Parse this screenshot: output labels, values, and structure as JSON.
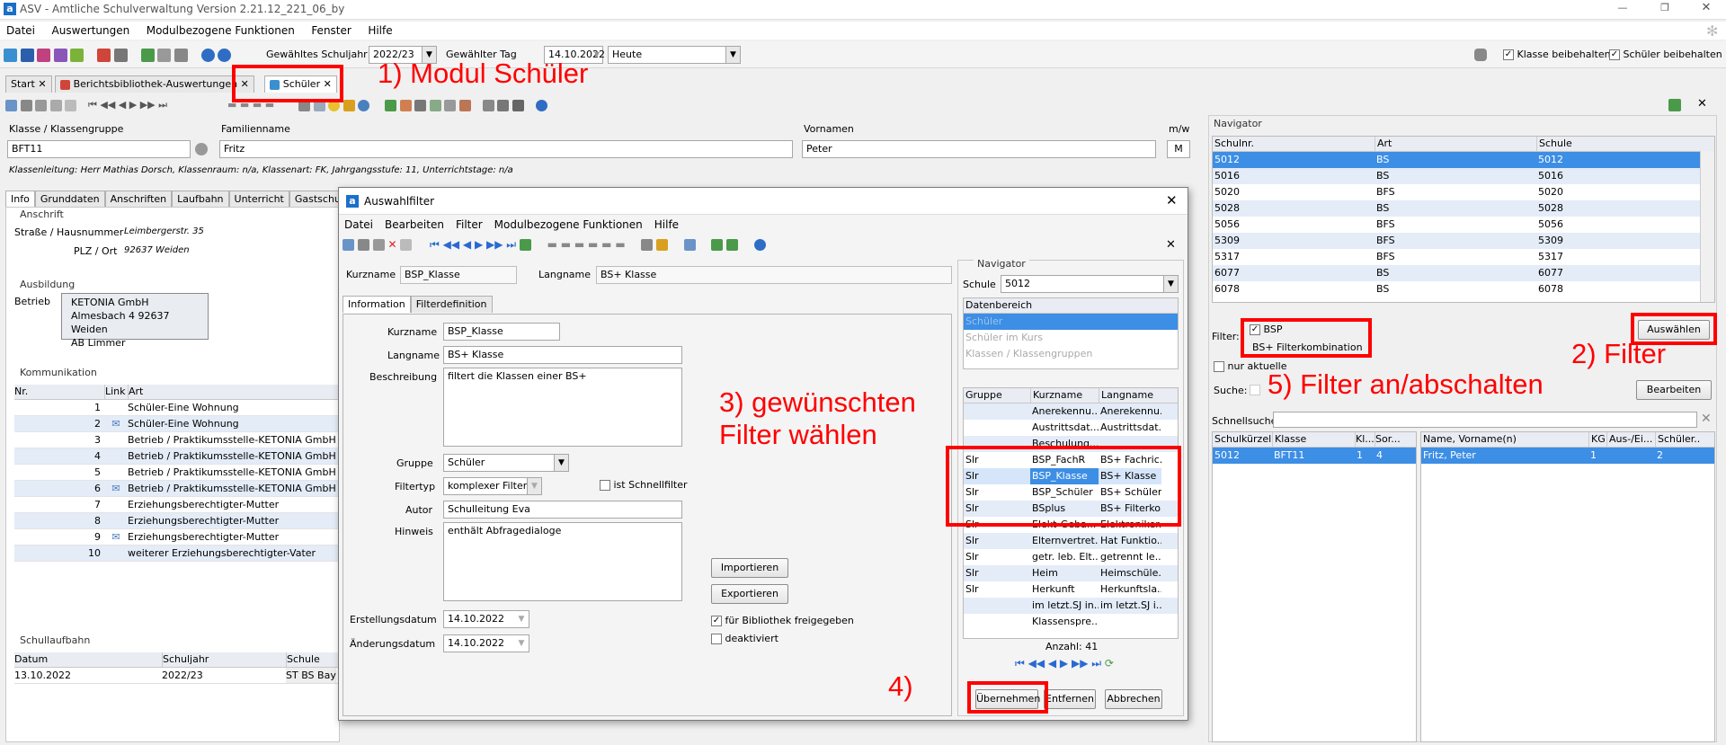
{
  "app": {
    "title": "ASV - Amtliche Schulverwaltung Version 2.21.12_221_06_by",
    "logo": "a"
  },
  "menu": [
    "Datei",
    "Auswertungen",
    "Modulbezogene Funktionen",
    "Fenster",
    "Hilfe"
  ],
  "toolbar": {
    "schuljahr_label": "Gewähltes Schuljahr",
    "schuljahr": "2022/23",
    "tag_label": "Gewählter Tag",
    "tag": "14.10.2022",
    "heute": "Heute",
    "klasse_beibehalten": "Klasse beibehalten",
    "schueler_beibehalten": "Schüler beibehalten"
  },
  "tabs": [
    "Start",
    "Berichtsbibliothek-Auswertungen",
    "Schüler"
  ],
  "student": {
    "klasse_label": "Klasse / Klassengruppe",
    "klasse": "BFT11",
    "familienname_label": "Familienname",
    "familienname": "Fritz",
    "vornamen_label": "Vornamen",
    "vornamen": "Peter",
    "mw_label": "m/w",
    "mw": "M",
    "info": "Klassenleitung: Herr Mathias Dorsch, Klassenraum: n/a, Klassenart: FK, Jahrgangsstufe: 11, Unterrichtstage: n/a"
  },
  "subtabs": [
    "Info",
    "Grunddaten",
    "Anschriften",
    "Laufbahn",
    "Unterricht",
    "Gastschulgene"
  ],
  "anschrift": {
    "title": "Anschrift",
    "strasse_label": "Straße / Hausnummer",
    "strasse": "Leimbergerstr. 35",
    "plz_label": "PLZ / Ort",
    "plz": "92637 Weiden"
  },
  "ausbildung": {
    "title": "Ausbildung",
    "betrieb_label": "Betrieb",
    "lines": [
      "KETONIA GmbH",
      "Almesbach 4 92637 Weiden",
      "AB Limmer"
    ]
  },
  "kommunikation": {
    "title": "Kommunikation",
    "headers": [
      "Nr.",
      "Link",
      "Art"
    ],
    "rows": [
      [
        "1",
        "",
        "Schüler-Eine Wohnung"
      ],
      [
        "2",
        "mail",
        "Schüler-Eine Wohnung"
      ],
      [
        "3",
        "",
        "Betrieb / Praktikumsstelle-KETONIA GmbH"
      ],
      [
        "4",
        "",
        "Betrieb / Praktikumsstelle-KETONIA GmbH"
      ],
      [
        "5",
        "",
        "Betrieb / Praktikumsstelle-KETONIA GmbH"
      ],
      [
        "6",
        "mail",
        "Betrieb / Praktikumsstelle-KETONIA GmbH"
      ],
      [
        "7",
        "",
        "Erziehungsberechtigter-Mutter"
      ],
      [
        "8",
        "",
        "Erziehungsberechtigter-Mutter"
      ],
      [
        "9",
        "mail",
        "Erziehungsberechtigter-Mutter"
      ],
      [
        "10",
        "",
        "weiterer Erziehungsberechtigter-Vater"
      ]
    ]
  },
  "schullaufbahn": {
    "title": "Schullaufbahn",
    "headers": [
      "Datum",
      "Schuljahr",
      "Schule"
    ],
    "row": [
      "13.10.2022",
      "2022/23",
      "ST BS Bayre"
    ]
  },
  "dialog": {
    "title": "Auswahlfilter",
    "menu": [
      "Datei",
      "Bearbeiten",
      "Filter",
      "Modulbezogene Funktionen",
      "Hilfe"
    ],
    "kurzname_label": "Kurzname",
    "kurzname": "BSP_Klasse",
    "langname_label": "Langname",
    "langname": "BS+ Klasse",
    "tabs": [
      "Information",
      "Filterdefinition"
    ],
    "beschreibung_label": "Beschreibung",
    "beschreibung": "filtert die Klassen einer BS+",
    "gruppe_label": "Gruppe",
    "gruppe": "Schüler",
    "filtertyp_label": "Filtertyp",
    "filtertyp": "komplexer Filter",
    "schnellfilter": "ist Schnellfilter",
    "autor_label": "Autor",
    "autor": "Schulleitung Eva",
    "hinweis_label": "Hinweis",
    "hinweis": "enthält Abfragedialoge",
    "importieren": "Importieren",
    "exportieren": "Exportieren",
    "freigegeben": "für Bibliothek freigegeben",
    "deaktiviert": "deaktiviert",
    "erstellung_label": "Erstellungsdatum",
    "erstellung": "14.10.2022",
    "aenderung_label": "Änderungsdatum",
    "aenderung": "14.10.2022",
    "nav": {
      "title": "Navigator",
      "schule_label": "Schule",
      "schule": "5012",
      "datenbereich": "Datenbereich",
      "bereiche": [
        "Schüler",
        "Schüler im Kurs",
        "Klassen / Klassengruppen"
      ],
      "headers": [
        "Gruppe",
        "Kurzname",
        "Langname"
      ],
      "rows": [
        [
          "",
          "Anerekennu...",
          "Anerekennu..."
        ],
        [
          "",
          "Austrittsdat...",
          "Austrittsdat..."
        ],
        [
          "",
          "Beschulung...",
          ""
        ],
        [
          "Slr",
          "BSP_FachR",
          "BS+ Fachric..."
        ],
        [
          "Slr",
          "BSP_Klasse",
          "BS+ Klasse"
        ],
        [
          "Slr",
          "BSP_Schüler",
          "BS+ Schüler..."
        ],
        [
          "Slr",
          "BSplus",
          "BS+ Filterko..."
        ],
        [
          "Slr",
          "Elekt-Geba...",
          "Elektroniker..."
        ],
        [
          "Slr",
          "Elternvertret...",
          "Hat Funktio..."
        ],
        [
          "Slr",
          "getr. leb. Elt...",
          "getrennt le..."
        ],
        [
          "Slr",
          "Heim",
          "Heimschüle..."
        ],
        [
          "Slr",
          "Herkunft",
          "Herkunftsla..."
        ],
        [
          "",
          "im letzt.SJ in...",
          "im letzt.SJ i..."
        ],
        [
          "",
          "Klassenspre...",
          ""
        ]
      ],
      "anzahl": "Anzahl: 41"
    },
    "uebernehmen": "Übernehmen",
    "entfernen": "Entfernen",
    "abbrechen": "Abbrechen"
  },
  "navigator": {
    "title": "Navigator",
    "headers": [
      "Schulnr.",
      "Art",
      "Schule"
    ],
    "rows": [
      [
        "5012",
        "BS",
        "5012"
      ],
      [
        "5016",
        "BS",
        "5016"
      ],
      [
        "5020",
        "BFS",
        "5020"
      ],
      [
        "5028",
        "BS",
        "5028"
      ],
      [
        "5056",
        "BFS",
        "5056"
      ],
      [
        "5309",
        "BFS",
        "5309"
      ],
      [
        "5317",
        "BFS",
        "5317"
      ],
      [
        "6077",
        "BS",
        "6077"
      ],
      [
        "6078",
        "BS",
        "6078"
      ]
    ],
    "filter_label": "Filter:",
    "filter_bsp": "BSP",
    "filter_combo": "BS+ Filterkombination",
    "auswaehlen": "Auswählen",
    "nur_aktuelle": "nur aktuelle",
    "suche": "Suche:",
    "bearbeiten": "Bearbeiten",
    "schnellsuche": "Schnellsuche",
    "left_headers": [
      "Schulkürzel",
      "Klasse",
      "Kl...",
      "Sor..."
    ],
    "left_row": [
      "5012",
      "BFT11",
      "1",
      "4"
    ],
    "right_headers": [
      "Name, Vorname(n)",
      "KG",
      "Aus-/Ei...",
      "Schüler..."
    ],
    "right_row": [
      "Fritz, Peter",
      "1",
      "",
      "2"
    ]
  },
  "annotations": {
    "a1": "1) Modul Schüler",
    "a2": "2) Filter",
    "a3": "3) gewünschten Filter wählen",
    "a4": "4)",
    "a5": "5) Filter an/abschalten"
  }
}
